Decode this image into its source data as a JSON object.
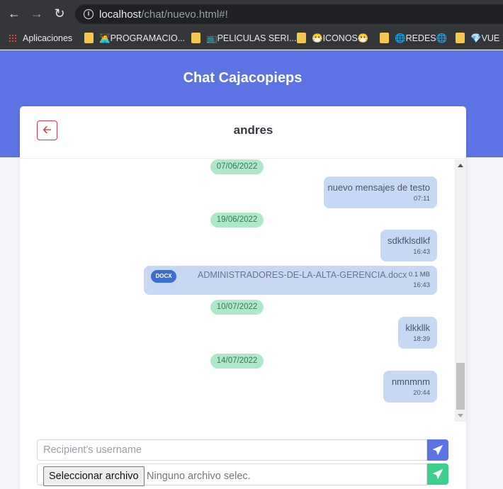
{
  "browser": {
    "url_host": "localhost",
    "url_path": "/chat/nuevo.html#!",
    "bookmarks": [
      {
        "label": "Aplicaciones",
        "icon": "apps-grid-icon"
      },
      {
        "label": "🧑‍💻PROGRAMACIO...",
        "icon": "folder-icon"
      },
      {
        "label": "📺PELICULAS SERI...",
        "icon": "folder-icon"
      },
      {
        "label": "😷ICONOS😷",
        "icon": "folder-icon"
      },
      {
        "label": "🌐REDES🌐",
        "icon": "folder-icon"
      },
      {
        "label": "💎VUE",
        "icon": "folder-icon"
      }
    ]
  },
  "page": {
    "title": "Chat Cajacopieps"
  },
  "chat": {
    "contact_name": "andres",
    "messages": [
      {
        "type": "date",
        "text": "07/06/2022"
      },
      {
        "type": "text",
        "text": "nuevo mensajes de testo",
        "time": "07:11"
      },
      {
        "type": "date",
        "text": "19/06/2022"
      },
      {
        "type": "text",
        "text": "sdkfklsdlkf",
        "time": "16:43"
      },
      {
        "type": "file",
        "badge": "DOCX",
        "name": "ADMINISTRADORES-DE-LA-ALTA-GERENCIA.docx",
        "size": "0.1 MB",
        "time": "16:43"
      },
      {
        "type": "date",
        "text": "10/07/2022"
      },
      {
        "type": "text",
        "text": "klkkllk",
        "time": "18:39"
      },
      {
        "type": "date",
        "text": "14/07/2022"
      },
      {
        "type": "text",
        "text": "nmnmnm",
        "time": "20:44"
      }
    ]
  },
  "composer": {
    "message_placeholder": "Recipient's username",
    "file_button_label": "Seleccionar archivo",
    "file_status": "Ninguno archivo selec."
  },
  "colors": {
    "brand": "#5c73e3",
    "send_primary": "#5c73e3",
    "send_success": "#3ccf8e",
    "bubble": "#c7d8f5",
    "date_pill": "#aee8c8",
    "back": "#dc3545"
  }
}
